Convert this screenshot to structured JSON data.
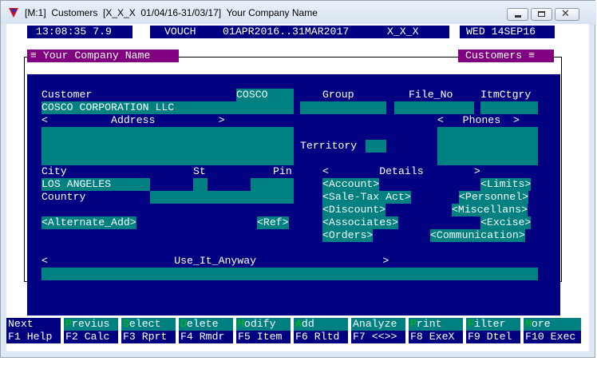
{
  "window": {
    "title": "[M:1]  Customers  [X_X_X  01/04/16-31/03/17]  Your Company Name"
  },
  "status": {
    "time": "13:08:35 7.9",
    "mode": "VOUCH",
    "period": "01APR2016..31MAR2017",
    "code": "X_X_X",
    "date": "WED 14SEP16"
  },
  "header": {
    "company": "≡ Your Company Name",
    "module": "Customers ≡"
  },
  "form": {
    "customer_label": "Customer",
    "customer_code": "COSCO",
    "customer_name": "COSCO CORPORATION LLC",
    "group_label": "Group",
    "file_no_label": "File_No",
    "itm_ctgry_label": "ItmCtgry",
    "address_header": "<          Address          >",
    "phones_header": "<   Phones  >",
    "territory_label": "Territory",
    "city_label": "City",
    "st_label": "St",
    "pin_label": "Pin",
    "city_value": "LOS ANGELES",
    "country_label": "Country",
    "alt_add_button": "<Alternate_Add>",
    "ref_button": "<Ref>",
    "details_header": "<        Details        >",
    "use_header": "<                    Use_It_Anyway                    >"
  },
  "details": {
    "account": "<Account>",
    "limits": "<Limits>",
    "sale_tax": "<Sale-Tax Act>",
    "personnel": "<Personnel>",
    "discount": "<Discount>",
    "miscellans": "<Miscellans>",
    "associates": "<Associates>",
    "excise": "<Excise>",
    "orders": "<Orders>",
    "communication": "<Communication>"
  },
  "fkeys": [
    {
      "hot": "N",
      "rest": "ext",
      "bottom": "F1 Help"
    },
    {
      "hot": "P",
      "rest": "revius",
      "bottom": "F2 Calc"
    },
    {
      "hot": "S",
      "rest": "elect",
      "bottom": "F3 Rprt"
    },
    {
      "hot": "D",
      "rest": "elete",
      "bottom": "F4 Rmdr"
    },
    {
      "hot": "M",
      "rest": "odify",
      "bottom": "F5 Item"
    },
    {
      "hot": "A",
      "rest": "dd",
      "bottom": "F6 Rltd"
    },
    {
      "hot": "",
      "rest": "Analyze",
      "bottom": "F7 <<>>"
    },
    {
      "hot": "P",
      "rest": "rint",
      "bottom": "F8 ExeX"
    },
    {
      "hot": "F",
      "rest": "ilter",
      "bottom": "F9 Dtel"
    },
    {
      "hot": "M",
      "rest": "ore",
      "bottom": "F10 Exec"
    }
  ]
}
